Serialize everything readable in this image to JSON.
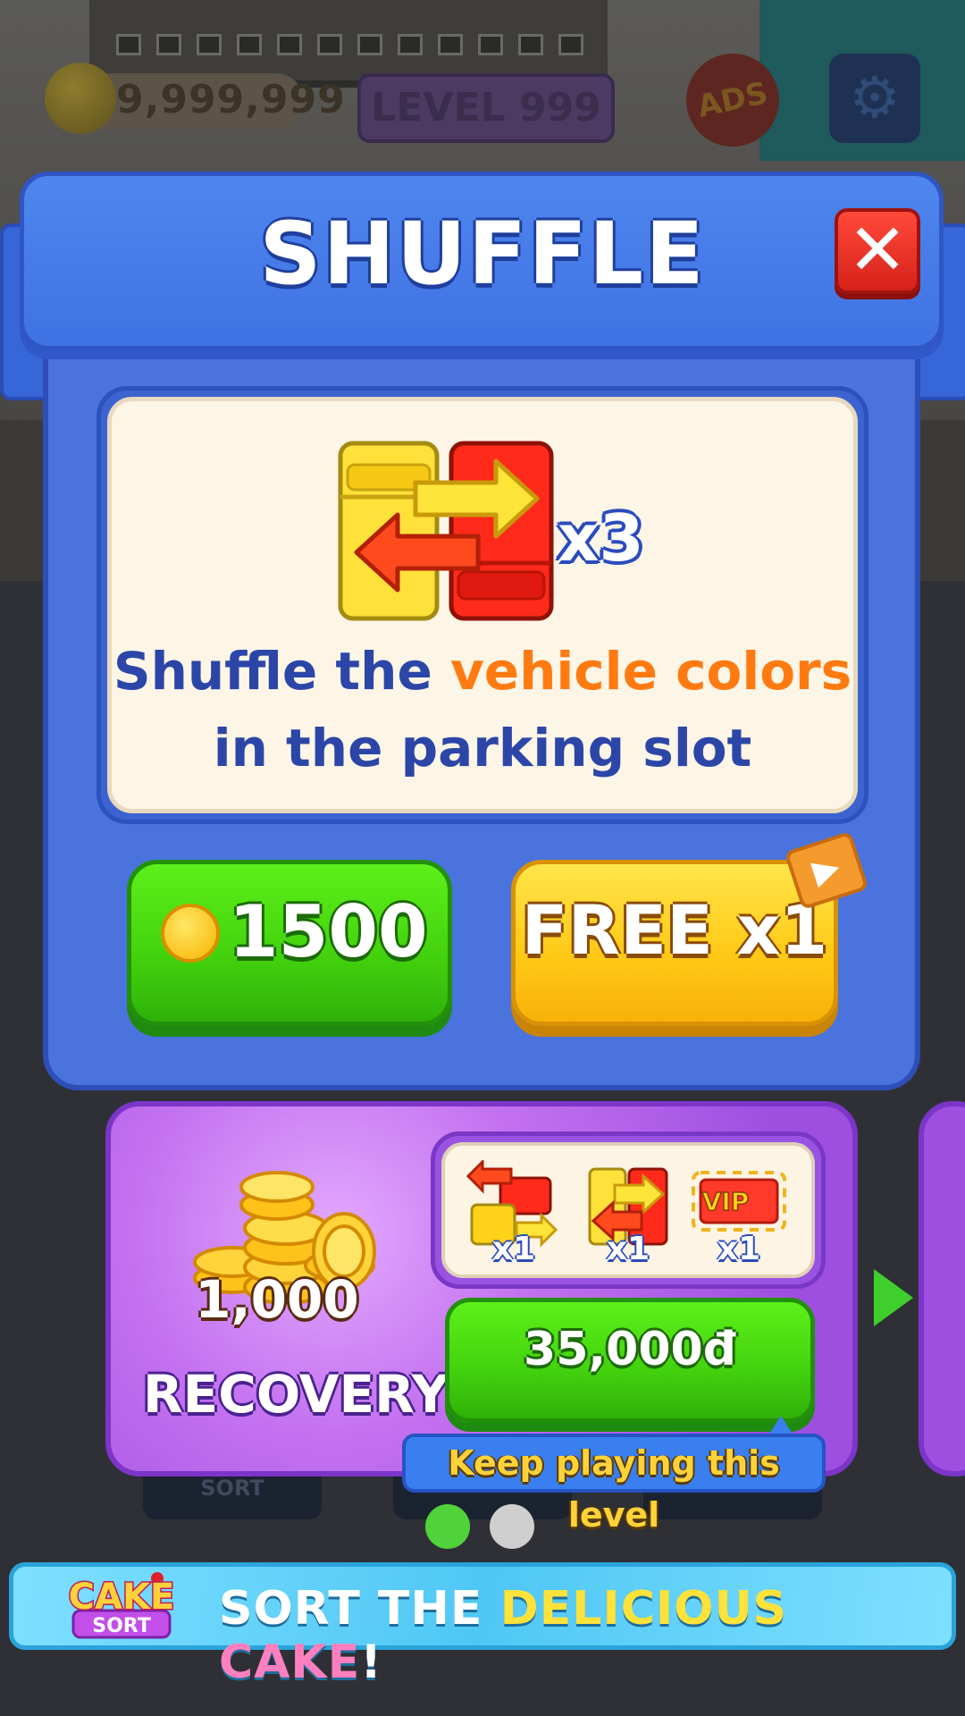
{
  "hud": {
    "coins": "9,999,999",
    "level": "LEVEL 999",
    "ads_label": "ADS"
  },
  "dialog": {
    "title": "SHUFFLE",
    "close_label": "✕",
    "multiplier": "x3",
    "description_part1": "Shuffle the ",
    "description_highlight": "vehicle colors",
    "description_line2": "in the parking slot",
    "coin_price": "1500",
    "free_label": "FREE x1"
  },
  "offer": {
    "coin_amount": "1,000",
    "title": "RECOVERY",
    "items": [
      {
        "icon": "shuffle-blocks-icon",
        "qty": "x1"
      },
      {
        "icon": "swap-cars-icon",
        "qty": "x1"
      },
      {
        "icon": "vip-slot-icon",
        "qty": "x1",
        "badge": "VIP"
      }
    ],
    "price": "35,000đ",
    "tooltip": "Keep playing this level"
  },
  "bottom_nav": {
    "sort_label": "SORT"
  },
  "pagination": {
    "active_color": "#4fd23a",
    "inactive_color": "#cfcfcf"
  },
  "banner": {
    "logo_line1": "CAKE",
    "logo_line2": "SORT",
    "text_part1": "SORT THE ",
    "text_part2": "DELICIOUS",
    "text_part3": " CAKE",
    "text_part4": "!"
  }
}
